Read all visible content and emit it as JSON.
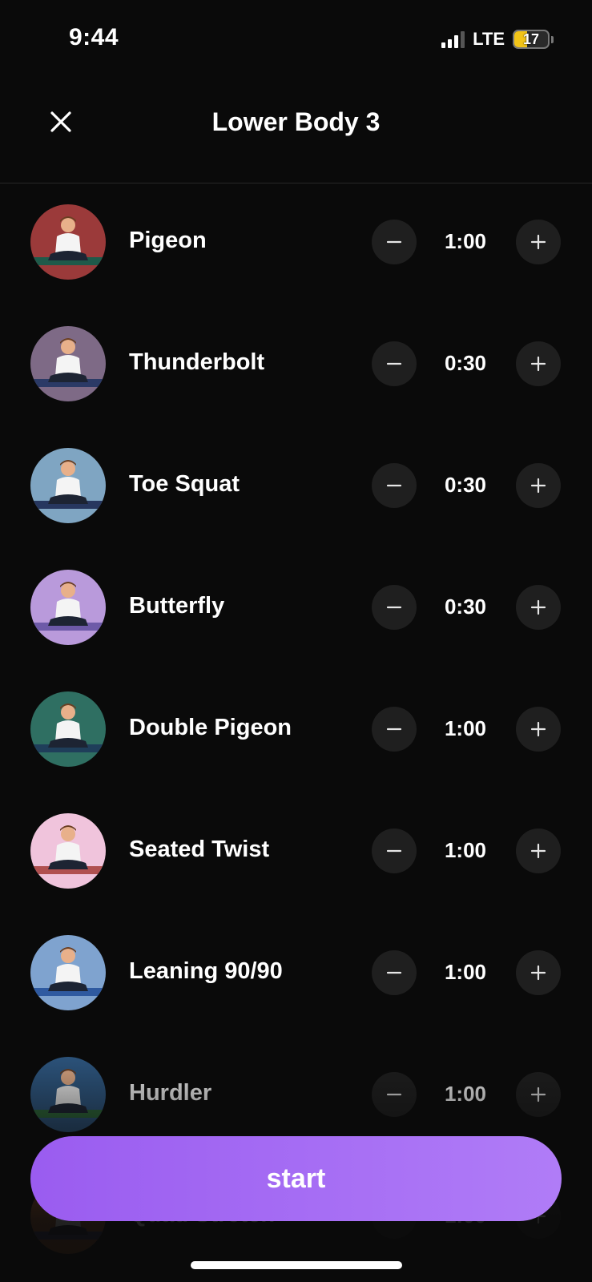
{
  "status_bar": {
    "time": "9:44",
    "network": "LTE",
    "battery_level": "17",
    "battery_fraction": 0.17,
    "battery_color": "#f2c418"
  },
  "header": {
    "title": "Lower Body 3",
    "close_icon": "close-icon"
  },
  "exercises": [
    {
      "name": "Pigeon",
      "duration": "1:00",
      "bg": "#9b3a3a",
      "mat": "#1f5a4a"
    },
    {
      "name": "Thunderbolt",
      "duration": "0:30",
      "bg": "#7e6a86",
      "mat": "#2b3a66"
    },
    {
      "name": "Toe Squat",
      "duration": "0:30",
      "bg": "#7fa5c2",
      "mat": "#27375f"
    },
    {
      "name": "Butterfly",
      "duration": "0:30",
      "bg": "#b99adb",
      "mat": "#6d5aa8"
    },
    {
      "name": "Double Pigeon",
      "duration": "1:00",
      "bg": "#2f6f62",
      "mat": "#1f3e5a"
    },
    {
      "name": "Seated Twist",
      "duration": "1:00",
      "bg": "#f0c4dc",
      "mat": "#b05050"
    },
    {
      "name": "Leaning 90/90",
      "duration": "1:00",
      "bg": "#7fa3cf",
      "mat": "#2f5aa0"
    },
    {
      "name": "Hurdler",
      "duration": "1:00",
      "bg": "#2f5a86",
      "mat": "#2f6e3c"
    },
    {
      "name": "Quad Stretch",
      "duration": "1:00",
      "bg": "#a0562a",
      "mat": "#3b3b6b"
    }
  ],
  "controls": {
    "minus_icon": "minus-icon",
    "plus_icon": "plus-icon"
  },
  "start_button": {
    "label": "start",
    "color_start": "#9a5cf0",
    "color_end": "#b07cf7"
  }
}
